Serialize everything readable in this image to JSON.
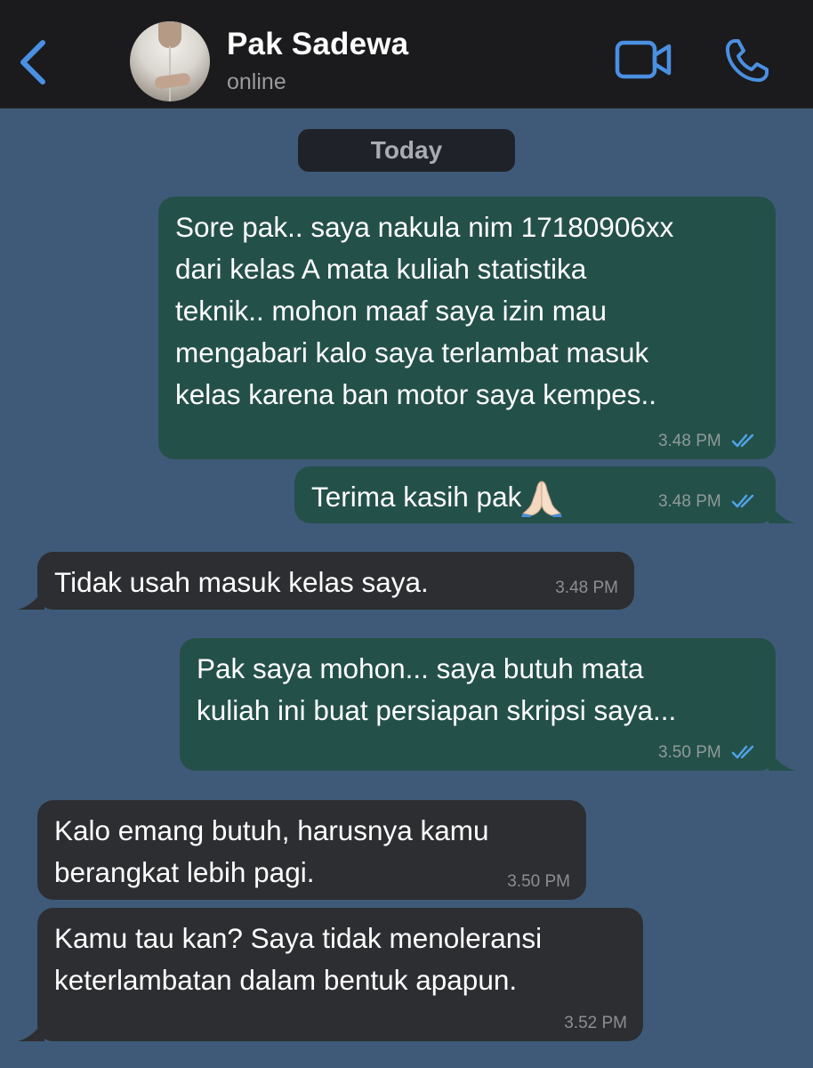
{
  "header": {
    "contact_name": "Pak Sadewa",
    "status": "online",
    "back_icon": "chevron-left-icon",
    "video_icon": "video-camera-icon",
    "call_icon": "phone-icon",
    "accent_color": "#4a90e2"
  },
  "date_separator": "Today",
  "messages": [
    {
      "direction": "outgoing",
      "lines": [
        "Sore pak.. saya nakula nim 17180906xx",
        "dari kelas A mata kuliah statistika",
        "teknik.. mohon maaf saya izin mau",
        "mengabari kalo saya terlambat masuk",
        "kelas karena ban motor saya kempes.."
      ],
      "time": "3.48 PM",
      "read": true
    },
    {
      "direction": "outgoing",
      "lines": [
        "Terima kasih pak"
      ],
      "emoji": "folded-hands",
      "time": "3.48 PM",
      "read": true
    },
    {
      "direction": "incoming",
      "lines": [
        "Tidak usah masuk kelas saya."
      ],
      "time": "3.48 PM"
    },
    {
      "direction": "outgoing",
      "lines": [
        "Pak saya mohon... saya butuh mata",
        "kuliah ini buat persiapan skripsi saya..."
      ],
      "time": "3.50 PM",
      "read": true
    },
    {
      "direction": "incoming",
      "lines": [
        "Kalo emang butuh, harusnya kamu",
        "berangkat lebih pagi."
      ],
      "time": "3.50 PM"
    },
    {
      "direction": "incoming",
      "lines": [
        "Kamu tau kan? Saya tidak menoleransi",
        "keterlambatan dalam bentuk apapun."
      ],
      "time": "3.52 PM"
    }
  ],
  "colors": {
    "chat_background": "#3f5a78",
    "outgoing_bubble": "#24504a",
    "incoming_bubble": "#2d2e32",
    "read_ticks": "#4fa3e8"
  }
}
